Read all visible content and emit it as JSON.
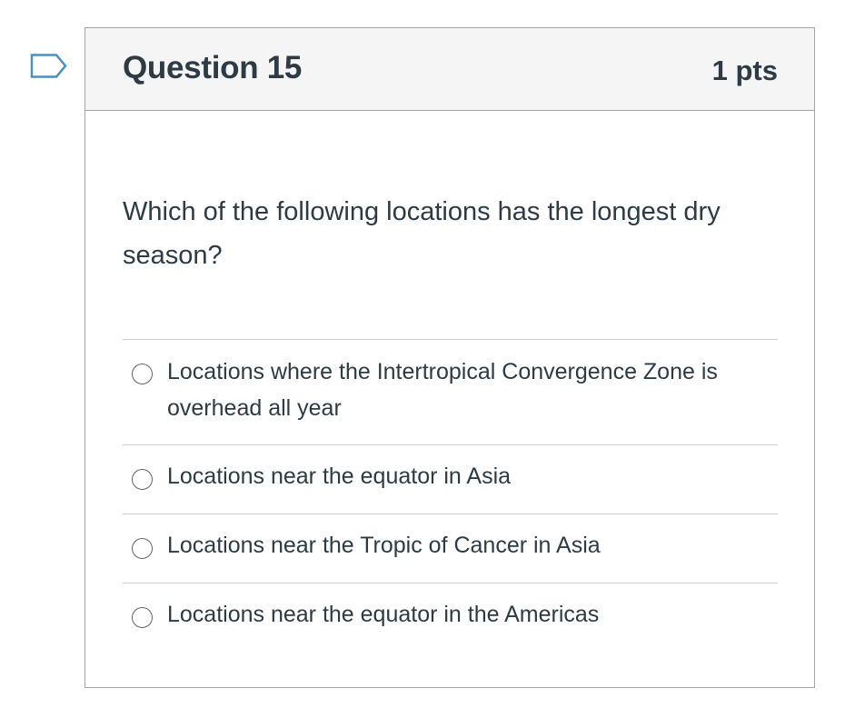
{
  "question": {
    "title": "Question 15",
    "points": "1 pts",
    "text": "Which of the following locations has the longest dry season?",
    "flag_icon": "bookmark-flag-outline",
    "answers": [
      {
        "label": "Locations where the Intertropical Convergence Zone is overhead all year",
        "selected": false
      },
      {
        "label": "Locations near the equator in Asia",
        "selected": false
      },
      {
        "label": "Locations near the Tropic of Cancer in Asia",
        "selected": false
      },
      {
        "label": "Locations near the equator in the Americas",
        "selected": false
      }
    ]
  },
  "colors": {
    "text": "#2d3b45",
    "header_bg": "#f5f5f5",
    "border": "#a5a5a5",
    "divider": "#c7cdd1",
    "flag_stroke": "#4a90c2"
  }
}
